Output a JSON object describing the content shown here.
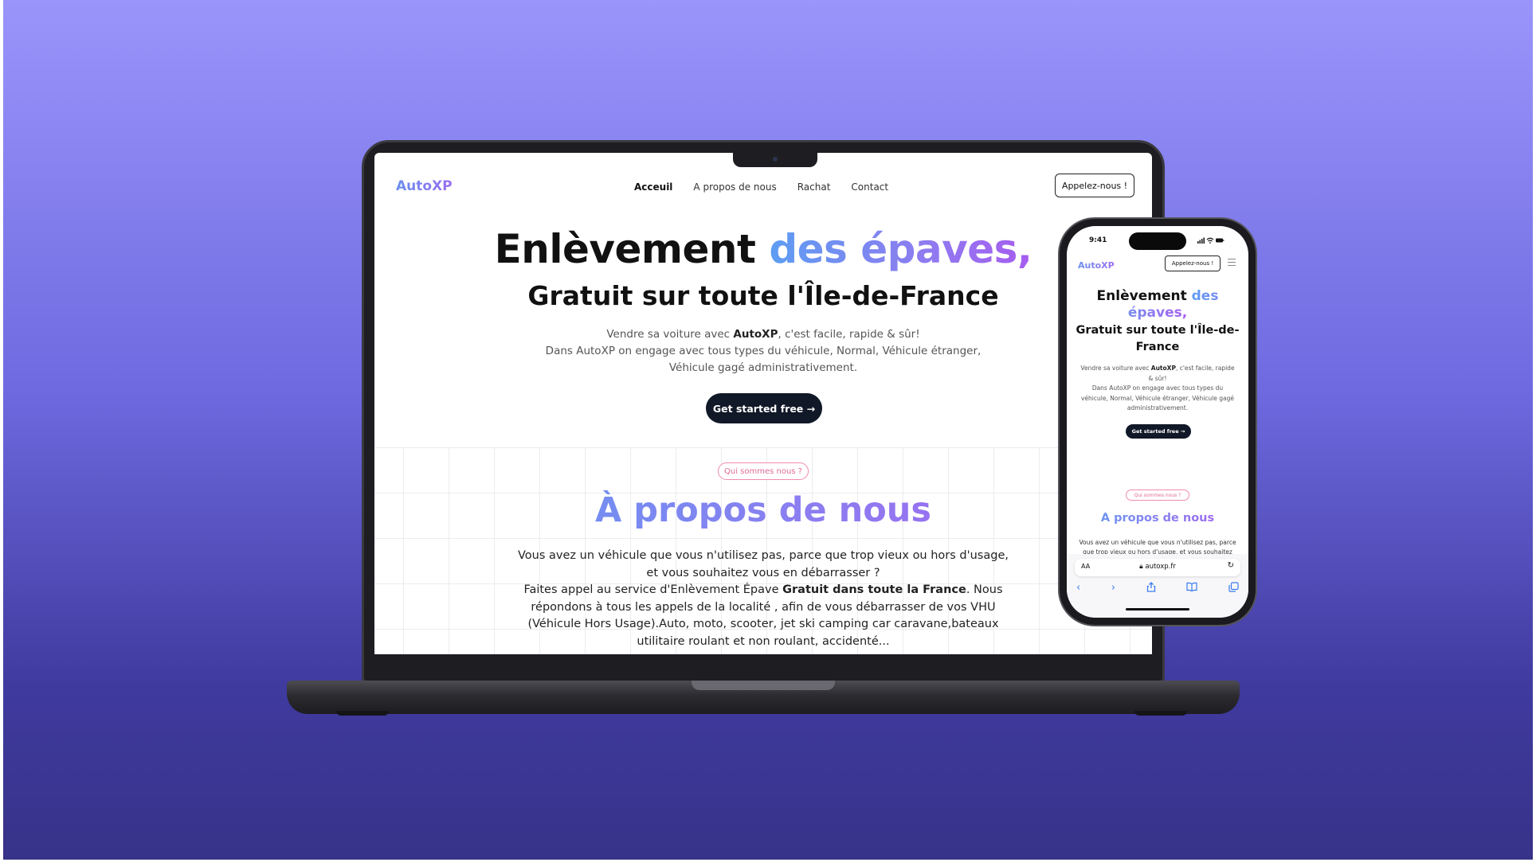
{
  "site": {
    "logo": "AutoXP",
    "nav": [
      "Acceuil",
      "A propos de nous",
      "Rachat",
      "Contact"
    ],
    "cta": "Appelez-nous !",
    "hero_title_plain": "Enlèvement ",
    "hero_title_accent": "des épaves,",
    "hero_subtitle": "Gratuit sur toute l'Île-de-France",
    "hero_desc_pre": "Vendre sa voiture avec ",
    "hero_desc_brand": "AutoXP",
    "hero_desc_post": ", c'est facile, rapide & sûr!",
    "hero_desc_line2": "Dans AutoXP on engage avec tous types du véhicule, Normal, Véhicule étranger, Véhicule gagé administrativement.",
    "hero_button": "Get started free →",
    "about_badge": "Qui sommes nous ?",
    "about_title": "À propos de nous",
    "about_p1": "Vous avez un véhicule que vous n'utilisez pas, parce que trop vieux ou hors d'usage, et vous souhaitez vous en débarrasser ?",
    "about_p2_pre": "Faites appel au service d'Enlèvement Épave ",
    "about_p2_bold": "Gratuit dans toute la France",
    "about_p2_post": ". Nous répondons à tous les appels de la localité , afin de vous débarrasser de vos VHU (Véhicule Hors Usage).Auto, moto, scooter, jet ski camping car caravane,bateaux utilitaire roulant et non roulant, accidenté..."
  },
  "phone": {
    "time": "9:41",
    "url": "autoxp.fr",
    "aa": "AA",
    "title_plain": "Enlèvement ",
    "title_accent": "des épaves,",
    "about_body": "Vous avez un véhicule que vous n'utilisez pas, parce que trop vieux ou hors d'usage, et vous souhaitez"
  },
  "colors": {
    "background_top": "#9a95fb",
    "background_bottom": "#373389",
    "accent_blue": "#5d9df2",
    "accent_purple": "#a65cf0",
    "button_dark": "#111827",
    "badge_pink": "#e06a98"
  },
  "icons": [
    "menu-icon",
    "back-icon",
    "forward-icon",
    "share-icon",
    "bookmarks-icon",
    "tabs-icon",
    "reload-icon",
    "lock-icon"
  ]
}
